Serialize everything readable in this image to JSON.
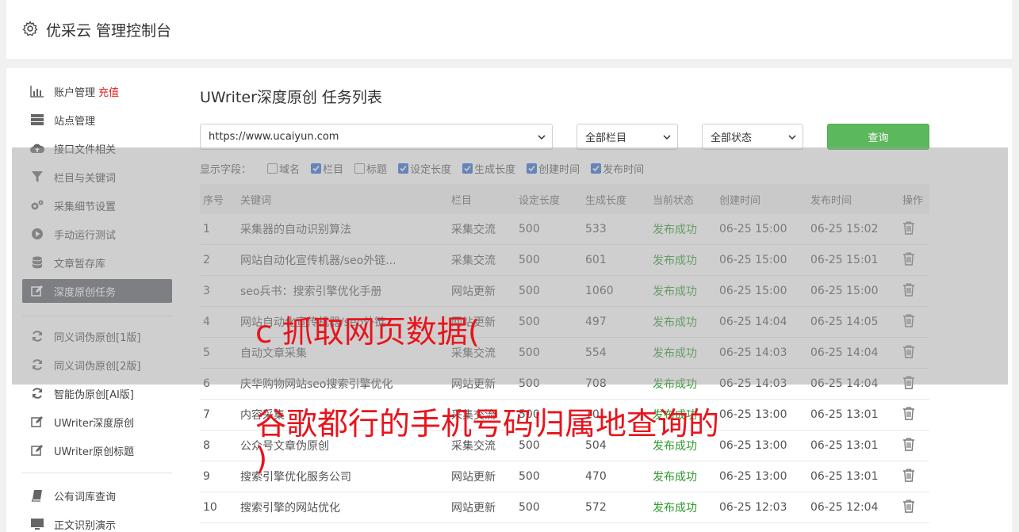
{
  "header": {
    "title": "优采云 管理控制台",
    "icon": "gear-icon"
  },
  "sidebar": {
    "items": [
      {
        "label": "账户管理",
        "extra": "充值",
        "icon": "bar-chart-icon"
      },
      {
        "label": "站点管理",
        "icon": "server-icon"
      },
      {
        "label": "接口文件相关",
        "icon": "cloud-upload-icon"
      },
      {
        "label": "栏目与关键词",
        "icon": "filter-icon"
      },
      {
        "label": "采集细节设置",
        "icon": "gears-icon"
      },
      {
        "label": "手动运行测试",
        "icon": "play-circle-icon"
      },
      {
        "label": "文章暂存库",
        "icon": "database-icon"
      },
      {
        "label": "深度原创任务",
        "icon": "edit-icon",
        "active": true
      },
      {
        "label": "同义词伪原创[1版]",
        "icon": "refresh-icon"
      },
      {
        "label": "同义词伪原创[2版]",
        "icon": "refresh-icon"
      },
      {
        "label": "智能伪原创[AI版]",
        "icon": "refresh-icon"
      },
      {
        "label": "UWriter深度原创",
        "icon": "edit-icon"
      },
      {
        "label": "UWriter原创标题",
        "icon": "edit-icon"
      },
      {
        "label": "公有词库查询",
        "icon": "book-icon"
      },
      {
        "label": "正文识别演示",
        "icon": "monitor-icon"
      }
    ]
  },
  "main": {
    "title": "UWriter深度原创 任务列表",
    "filters": {
      "site": "https://www.ucaiyun.com",
      "column": "全部栏目",
      "status": "全部状态",
      "query_label": "查询"
    },
    "display_fields": {
      "label": "显示字段：",
      "options": [
        {
          "label": "域名",
          "checked": false
        },
        {
          "label": "栏目",
          "checked": true
        },
        {
          "label": "标题",
          "checked": false
        },
        {
          "label": "设定长度",
          "checked": true
        },
        {
          "label": "生成长度",
          "checked": true
        },
        {
          "label": "创建时间",
          "checked": true
        },
        {
          "label": "发布时间",
          "checked": true
        }
      ]
    },
    "table": {
      "headers": [
        "序号",
        "关键词",
        "栏目",
        "设定长度",
        "生成长度",
        "当前状态",
        "创建时间",
        "发布时间",
        "操作"
      ],
      "rows": [
        [
          "1",
          "采集器的自动识别算法",
          "采集交流",
          "500",
          "533",
          "发布成功",
          "06-25 15:00",
          "06-25 15:02"
        ],
        [
          "2",
          "网站自动化宣传机器/seo外链...",
          "采集交流",
          "500",
          "601",
          "发布成功",
          "06-25 15:00",
          "06-25 15:01"
        ],
        [
          "3",
          "seo兵书：搜索引擎优化手册",
          "网站更新",
          "500",
          "1060",
          "发布成功",
          "06-25 15:00",
          "06-25 15:00"
        ],
        [
          "4",
          "网站自动化宣传机器/seo外链...",
          "网站更新",
          "500",
          "497",
          "发布成功",
          "06-25 14:04",
          "06-25 14:05"
        ],
        [
          "5",
          "自动文章采集",
          "采集交流",
          "500",
          "554",
          "发布成功",
          "06-25 14:03",
          "06-25 14:04"
        ],
        [
          "6",
          "庆华购物网站seo搜索引擎优化",
          "网站更新",
          "500",
          "708",
          "发布成功",
          "06-25 14:03",
          "06-25 14:04"
        ],
        [
          "7",
          "内容采集",
          "采集交流",
          "500",
          "10",
          "发布成功",
          "06-25 13:00",
          "06-25 13:01"
        ],
        [
          "8",
          "公众号文章伪原创",
          "采集交流",
          "500",
          "504",
          "发布成功",
          "06-25 13:00",
          "06-25 13:01"
        ],
        [
          "9",
          "搜索引擎优化服务公司",
          "网站更新",
          "500",
          "470",
          "发布成功",
          "06-25 13:00",
          "06-25 13:01"
        ],
        [
          "10",
          "搜索引擎的网站优化",
          "网站更新",
          "500",
          "572",
          "发布成功",
          "06-25 12:03",
          "06-25 12:04"
        ]
      ],
      "row_action_icon": "trash-icon"
    }
  },
  "watermark": {
    "line1": "c 抓取网页数据(",
    "line2": "谷歌都行的手机号码归属地查询的",
    "line3": ")",
    "color": "#e8141c"
  }
}
